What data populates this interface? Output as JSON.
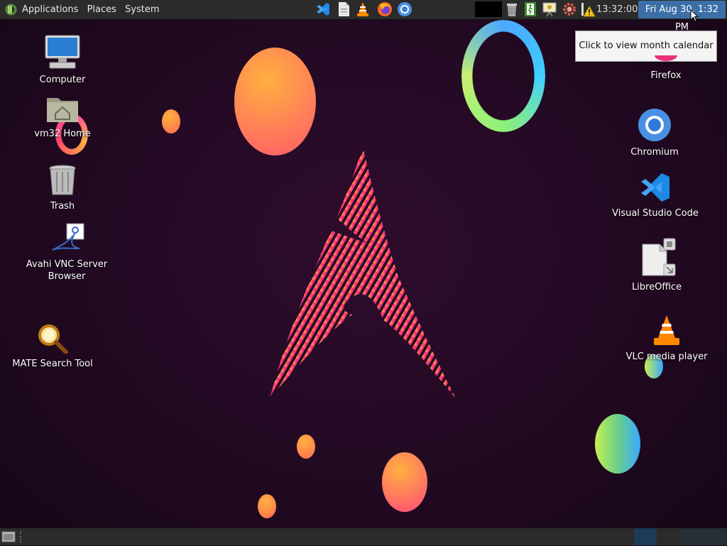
{
  "panel": {
    "menus": [
      "Applications",
      "Places",
      "System"
    ],
    "clock_time": "13:32:00",
    "clock_date": "Fri Aug 30,  1:32 PM"
  },
  "tooltip": {
    "text": "Click to view month calendar"
  },
  "desktop_left": [
    {
      "label": "Computer",
      "icon": "computer-icon"
    },
    {
      "label": "vm32 Home",
      "icon": "home-folder-icon"
    },
    {
      "label": "Trash",
      "icon": "trash-icon"
    },
    {
      "label": "Avahi VNC Server Browser",
      "line1": "Avahi VNC Server",
      "line2": "Browser",
      "icon": "avahi-vnc-icon"
    },
    {
      "label": "MATE Search Tool",
      "icon": "search-tool-icon"
    }
  ],
  "desktop_right": [
    {
      "label": "Firefox",
      "icon": "firefox-icon"
    },
    {
      "label": "Chromium",
      "icon": "chromium-icon"
    },
    {
      "label": "Visual Studio Code",
      "icon": "vscode-icon"
    },
    {
      "label": "LibreOffice",
      "icon": "libreoffice-icon"
    },
    {
      "label": "VLC media player",
      "icon": "vlc-icon"
    }
  ],
  "colors": {
    "panel": "#2b2b2b",
    "date_highlight": "#3c6fa8",
    "wallpaper": "#240a24",
    "arch_logo": "#e8317a"
  }
}
